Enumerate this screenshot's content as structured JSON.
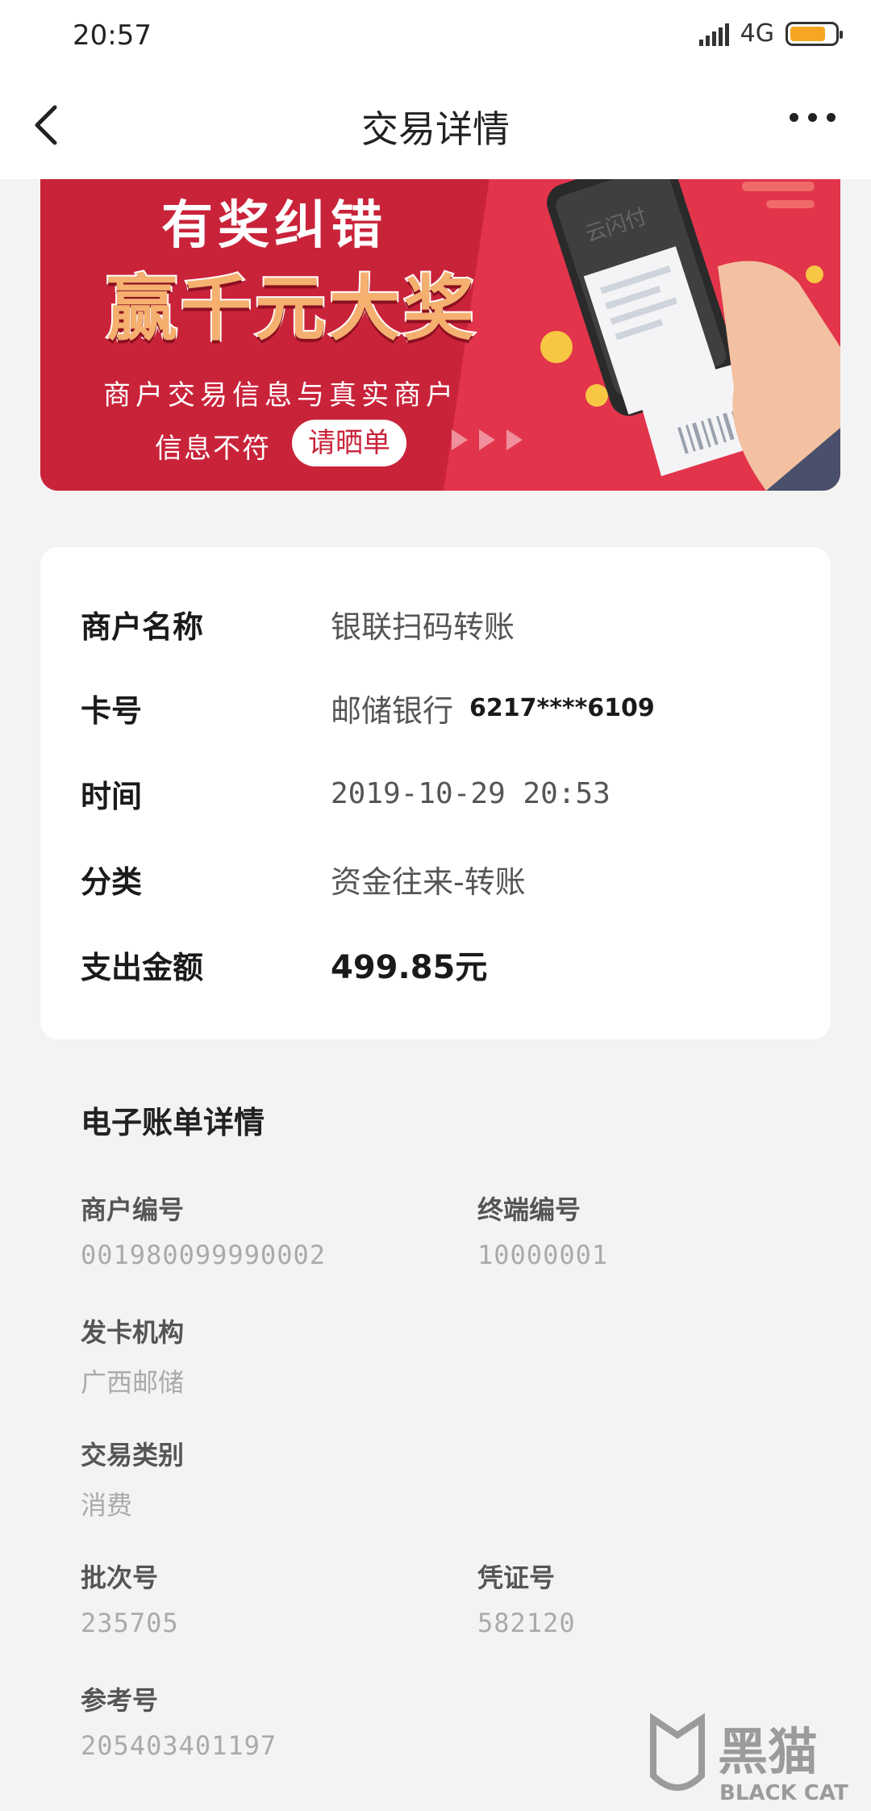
{
  "status_bar": {
    "time": "20:57",
    "network": "4G",
    "battery_level": 0.8
  },
  "header": {
    "title": "交易详情"
  },
  "banner": {
    "title": "有奖纠错",
    "headline": "赢千元大奖",
    "line1": "商户交易信息与真实商户",
    "line2": "信息不符",
    "cta": "请晒单",
    "phone_brand": "云闪付"
  },
  "transaction": {
    "merchant_label": "商户名称",
    "merchant_value": "银联扫码转账",
    "card_label": "卡号",
    "card_bank": "邮储银行",
    "card_number": "6217****6109",
    "time_label": "时间",
    "time_value": "2019-10-29 20:53",
    "category_label": "分类",
    "category_value": "资金往来-转账",
    "amount_label": "支出金额",
    "amount_value": "499.85元"
  },
  "ebill": {
    "title": "电子账单详情",
    "merchant_no_label": "商户编号",
    "merchant_no_value": "001980099990002",
    "terminal_no_label": "终端编号",
    "terminal_no_value": "10000001",
    "issuer_label": "发卡机构",
    "issuer_value": "广西邮储",
    "type_label": "交易类别",
    "type_value": "消费",
    "batch_label": "批次号",
    "batch_value": "235705",
    "voucher_label": "凭证号",
    "voucher_value": "582120",
    "reference_label": "参考号",
    "reference_value": "205403401197"
  },
  "watermark": {
    "text_cn": "黑猫",
    "text_en": "BLACK CAT"
  },
  "colors": {
    "brand_red": "#c9233a",
    "accent_gold": "#f5b070"
  }
}
